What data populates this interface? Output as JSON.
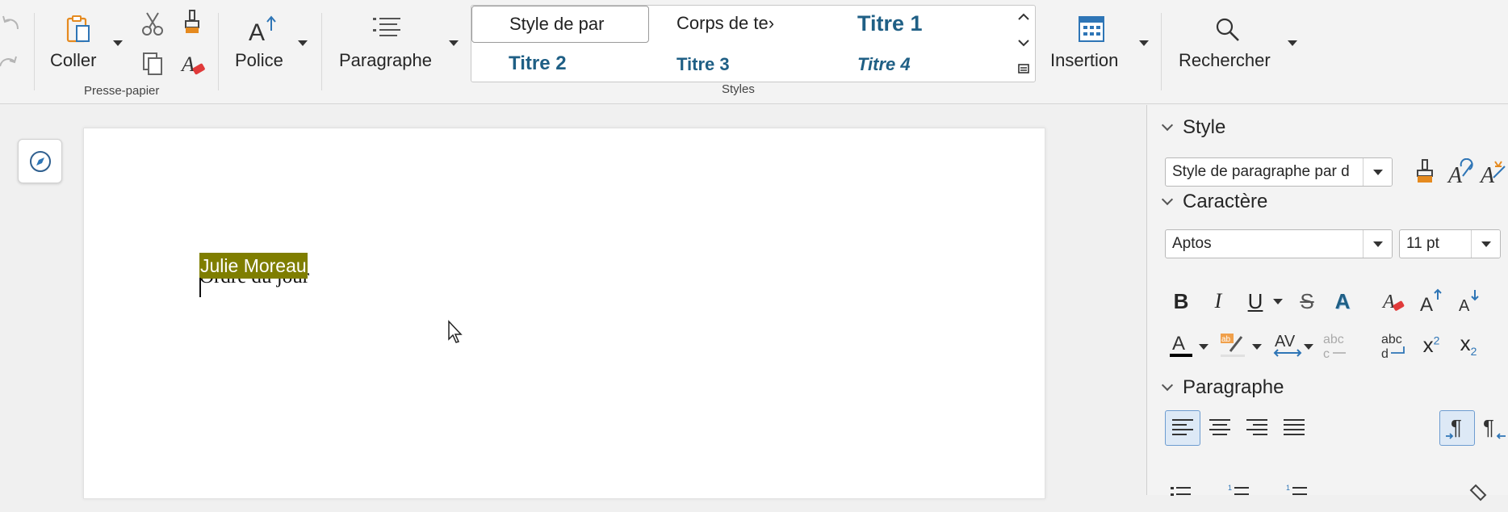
{
  "ribbon": {
    "clipboard": {
      "paste_label": "Coller",
      "group_label": "Presse-papier"
    },
    "font": {
      "label": "Police"
    },
    "paragraph": {
      "label": "Paragraphe"
    },
    "styles": {
      "group_label": "Styles",
      "items": [
        "Style de par",
        "Corps de te›",
        "Titre 1",
        "Titre 2",
        "Titre 3",
        "Titre 4"
      ]
    },
    "insert": {
      "label": "Insertion"
    },
    "find": {
      "label": "Rechercher"
    }
  },
  "document": {
    "lines": [
      "Julie Moreau",
      "Ordre du jour"
    ]
  },
  "sidebar": {
    "style": {
      "heading": "Style",
      "paragraph_style_value": "Style de paragraphe par d"
    },
    "character": {
      "heading": "Caractère",
      "font_name": "Aptos",
      "font_size": "11 pt"
    },
    "paragraph": {
      "heading": "Paragraphe"
    }
  },
  "colors": {
    "accent_blue": "#1f5f85",
    "highlight": "#7f7e00",
    "icon_blue": "#2e75b6",
    "icon_orange": "#e58a1f"
  }
}
